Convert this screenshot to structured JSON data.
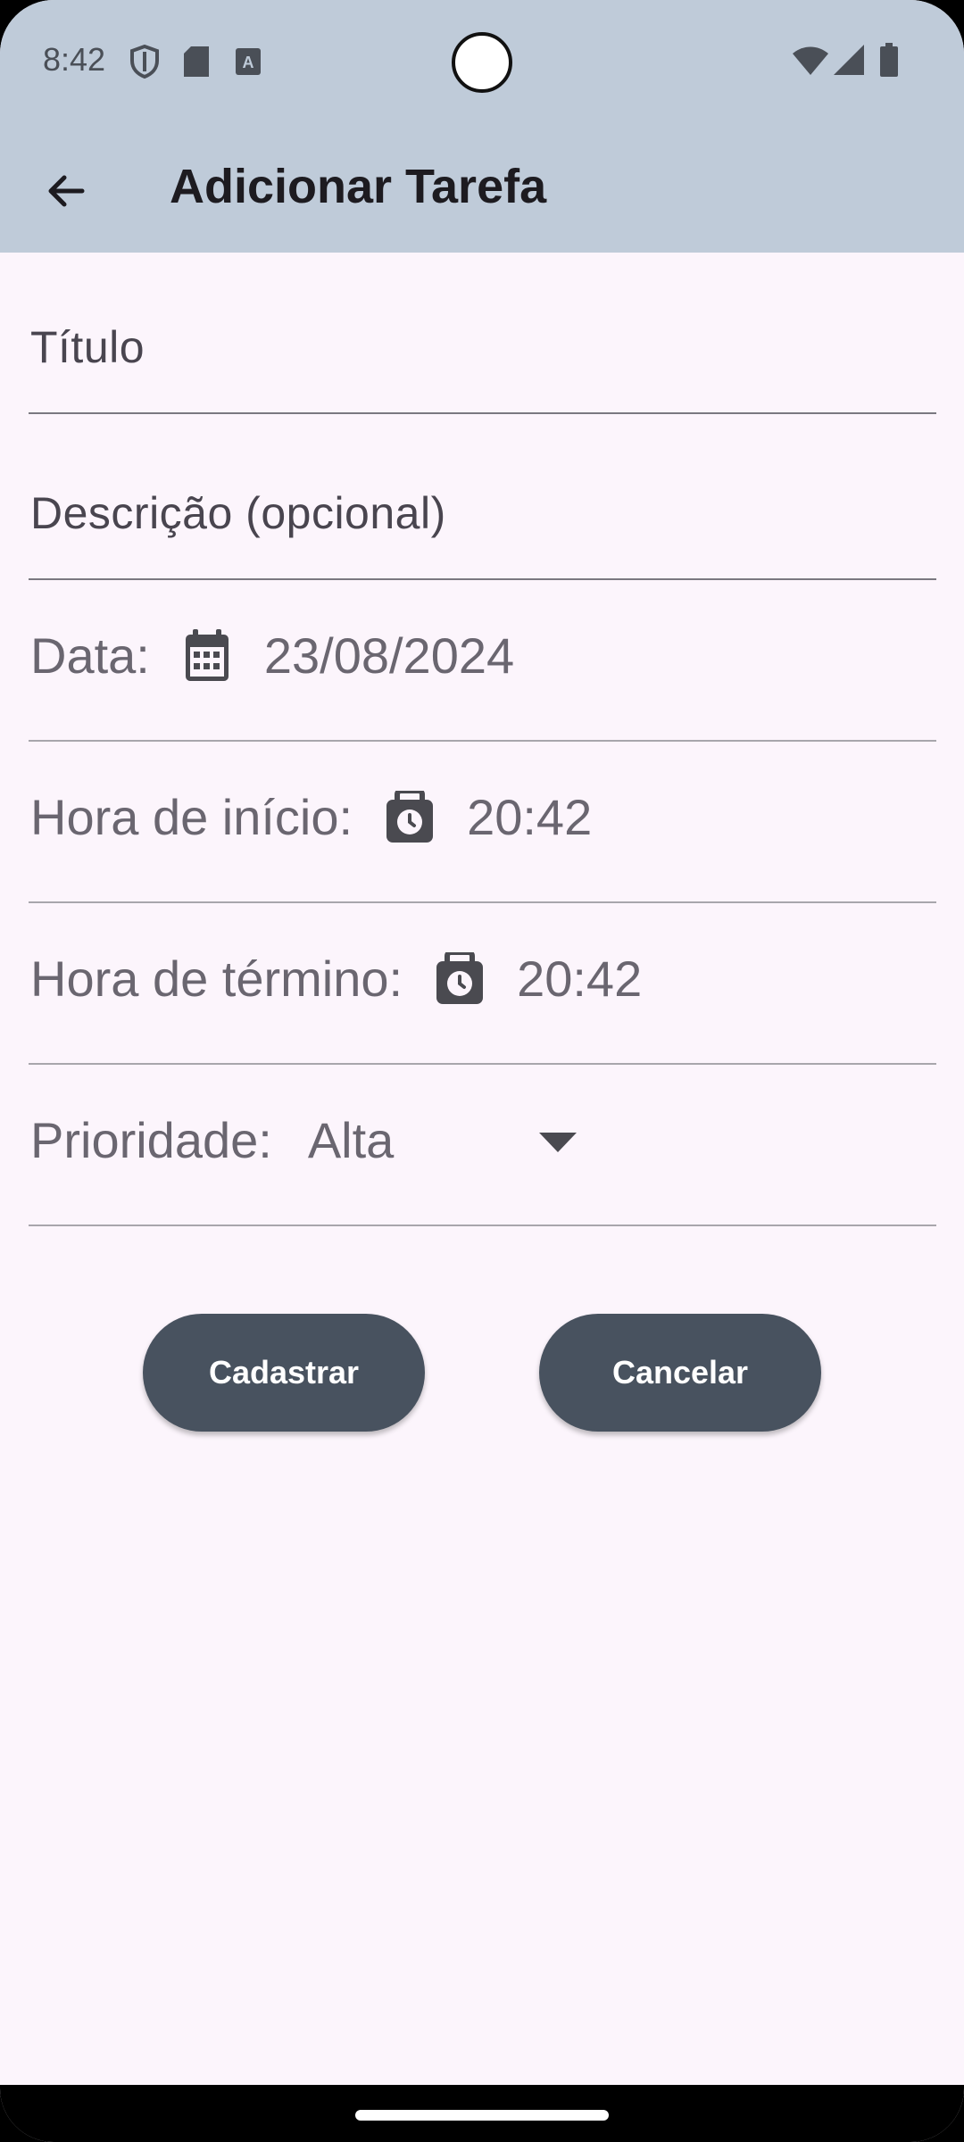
{
  "status_bar": {
    "time": "8:42",
    "icons": [
      "shield-icon",
      "sd-card-icon",
      "a-badge-icon",
      "wifi-icon",
      "signal-icon",
      "battery-icon"
    ]
  },
  "app_bar": {
    "title": "Adicionar Tarefa",
    "back_icon": "arrow-left-icon"
  },
  "form": {
    "titulo_placeholder": "Título",
    "descricao_placeholder": "Descrição (opcional)",
    "data_label": "Data:",
    "data_value": "23/08/2024",
    "hora_inicio_label": "Hora de início:",
    "hora_inicio_value": "20:42",
    "hora_termino_label": "Hora de término:",
    "hora_termino_value": "20:42",
    "prioridade_label": "Prioridade:",
    "prioridade_value": "Alta"
  },
  "buttons": {
    "cadastrar": "Cadastrar",
    "cancelar": "Cancelar"
  },
  "colors": {
    "app_bar": "#bfcbd9",
    "background": "#fcf5fc",
    "button": "#48525f",
    "text_muted": "#6a6670"
  }
}
